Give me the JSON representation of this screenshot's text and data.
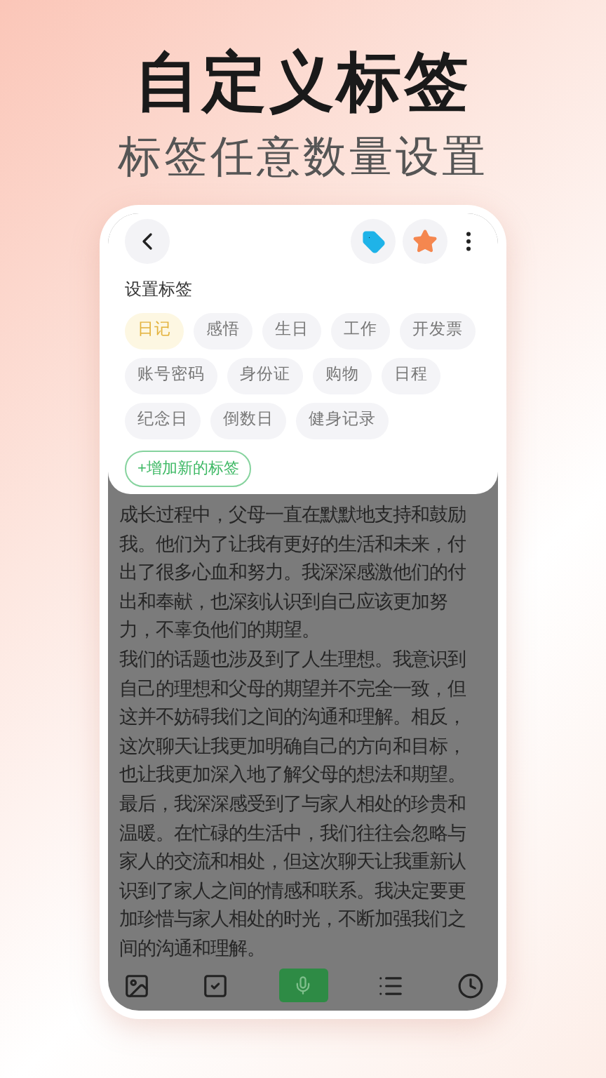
{
  "headline": "自定义标签",
  "subheadline": "标签任意数量设置",
  "tag_panel": {
    "title": "设置标签",
    "tags": [
      {
        "label": "日记",
        "selected": true
      },
      {
        "label": "感悟",
        "selected": false
      },
      {
        "label": "生日",
        "selected": false
      },
      {
        "label": "工作",
        "selected": false
      },
      {
        "label": "开发票",
        "selected": false
      },
      {
        "label": "账号密码",
        "selected": false
      },
      {
        "label": "身份证",
        "selected": false
      },
      {
        "label": "购物",
        "selected": false
      },
      {
        "label": "日程",
        "selected": false
      },
      {
        "label": "纪念日",
        "selected": false
      },
      {
        "label": "倒数日",
        "selected": false
      },
      {
        "label": "健身记录",
        "selected": false
      }
    ],
    "add_button": "+增加新的标签"
  },
  "note_lines": [
    "成长过程中，父母一直在默默地支持和鼓励",
    "我。他们为了让我有更好的生活和未来，付",
    "出了很多心血和努力。我深深感激他们的付",
    "出和奉献，也深刻认识到自己应该更加努",
    "力，不辜负他们的期望。",
    "我们的话题也涉及到了人生理想。我意识到",
    "自己的理想和父母的期望并不完全一致，但",
    "这并不妨碍我们之间的沟通和理解。相反，",
    "这次聊天让我更加明确自己的方向和目标，",
    "也让我更加深入地了解父母的想法和期望。",
    "最后，我深深感受到了与家人相处的珍贵和",
    "温暖。在忙碌的生活中，我们往往会忽略与",
    "家人的交流和相处，但这次聊天让我重新认",
    "识到了家人之间的情感和联系。我决定要更",
    "加珍惜与家人相处的时光，不断加强我们之",
    "间的沟通和理解。"
  ],
  "toolbar": [
    {
      "kind": "image",
      "selected": false
    },
    {
      "kind": "checklist",
      "selected": false
    },
    {
      "kind": "mic",
      "selected": true
    },
    {
      "kind": "list",
      "selected": false
    },
    {
      "kind": "clock",
      "selected": false
    }
  ]
}
